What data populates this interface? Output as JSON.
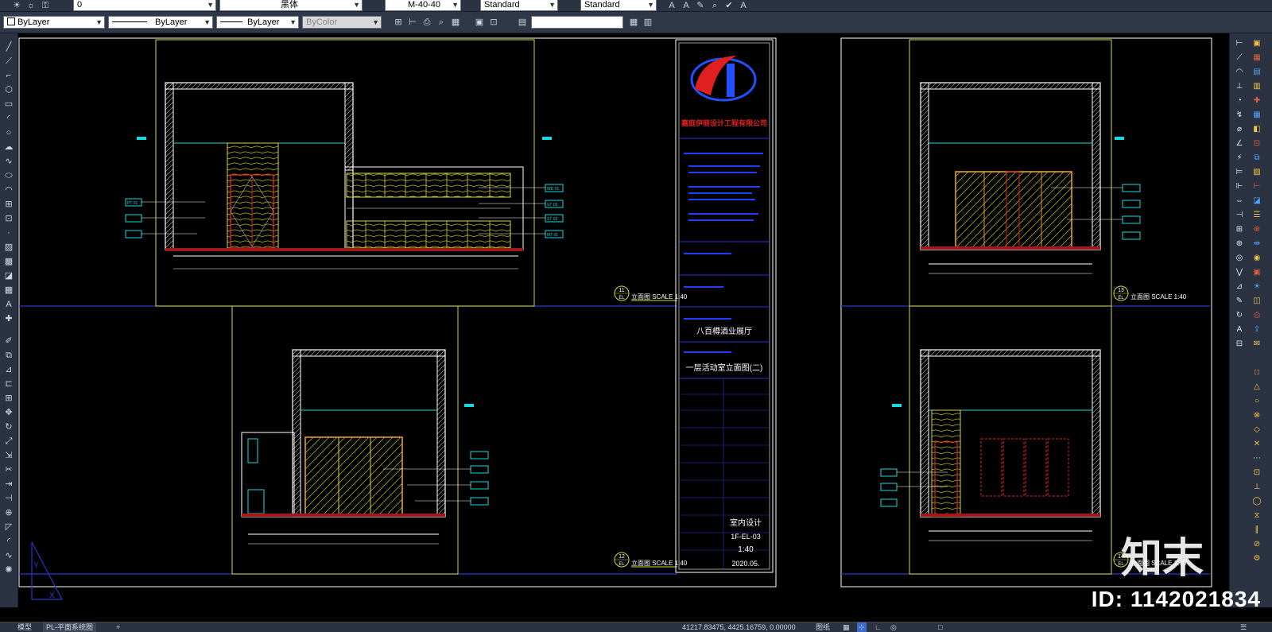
{
  "toolbar_top": {
    "layer_value": "0",
    "font_value": "黑体",
    "dim_style": "M-40-40",
    "table_style": "Standard",
    "mleader_style": "Standard"
  },
  "toolbar_props": {
    "color": "ByLayer",
    "linetype": "ByLayer",
    "lineweight": "ByLayer",
    "plotstyle": "ByColor"
  },
  "drawing": {
    "title_block": {
      "company": "嘉庭伊丽设计工程有限公司",
      "project_name": "八百樽酒业展厅",
      "drawing_name": "一层活动室立面图(二)",
      "discipline": "室内设计",
      "drawing_no": "1F-EL-03",
      "scale": "1:40",
      "date": "2020.05."
    },
    "views": [
      {
        "num": "11",
        "ref": "EL",
        "label": "立面图 SCALE 1:40"
      },
      {
        "num": "12",
        "ref": "EL",
        "label": "立面图 SCALE 1:40"
      },
      {
        "num": "13",
        "ref": "EL",
        "label": "立面图 SCALE 1:40"
      },
      {
        "num": "14",
        "ref": "EL",
        "label": "立面图 SCALE 1:40"
      }
    ],
    "tags": [
      "PT 01",
      "ST 02",
      "MT 01",
      "WD 01",
      "ST 03"
    ]
  },
  "watermark": {
    "brand": "知末",
    "id": "ID: 1142021834"
  },
  "status": {
    "tab_model": "模型",
    "tab_layout": "PL-平面系统图",
    "coords": "41217.83475, 4425.16759, 0.00000",
    "paper": "图纸"
  },
  "colors": {
    "ui_bg": "#2b3342",
    "frame_line": "#d8d83a",
    "viewport_line": "#2a36c8",
    "wall_line": "#ffffff",
    "accent_red": "#e02020",
    "accent_cyan": "#18d8e0"
  }
}
